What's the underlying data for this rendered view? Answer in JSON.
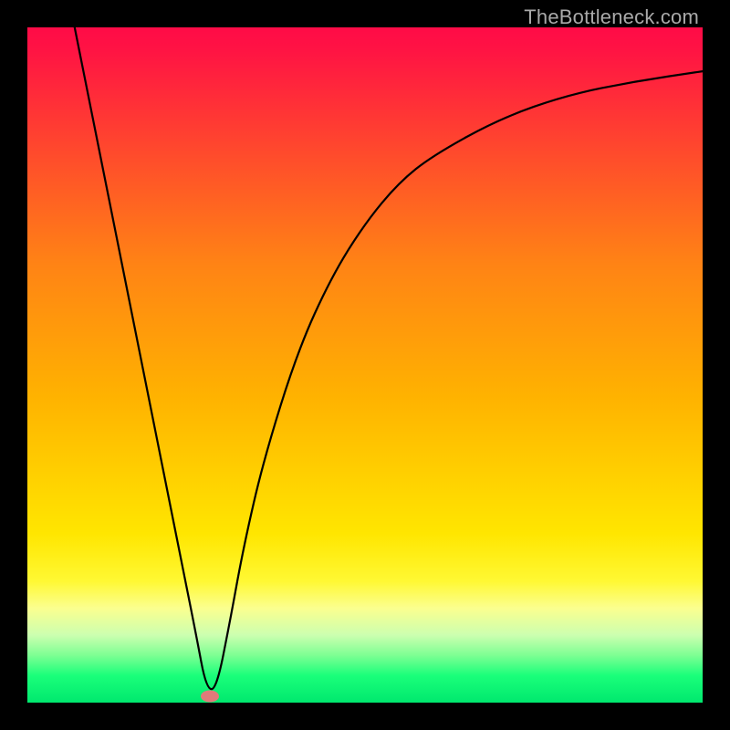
{
  "watermark": "TheBottleneck.com",
  "colors": {
    "background_frame": "#000000",
    "gradient_top": "#ff0b47",
    "gradient_bottom": "#00e86e",
    "curve_stroke": "#000000",
    "marker_fill": "#e07a7a",
    "watermark_text": "#a9a9a9"
  },
  "chart_data": {
    "type": "line",
    "title": "",
    "xlabel": "",
    "ylabel": "",
    "xlim": [
      0,
      1
    ],
    "ylim": [
      0,
      1
    ],
    "grid": false,
    "legend": false,
    "description": "V-shaped curve with vertex near x≈0.27 on a vertical red→green gradient background, black frame, site watermark top-right, small pink ellipse marker at the vertex.",
    "series": [
      {
        "name": "left-branch",
        "x": [
          0.07,
          0.09,
          0.11,
          0.13,
          0.15,
          0.17,
          0.19,
          0.21,
          0.23,
          0.25,
          0.265
        ],
        "values": [
          1.0,
          0.9,
          0.8,
          0.7,
          0.6,
          0.5,
          0.4,
          0.3,
          0.2,
          0.1,
          0.02
        ]
      },
      {
        "name": "right-branch",
        "x": [
          0.28,
          0.3,
          0.32,
          0.35,
          0.4,
          0.45,
          0.5,
          0.55,
          0.6,
          0.7,
          0.8,
          0.9,
          1.0
        ],
        "values": [
          0.02,
          0.12,
          0.23,
          0.36,
          0.52,
          0.63,
          0.71,
          0.77,
          0.81,
          0.865,
          0.9,
          0.92,
          0.935
        ]
      }
    ],
    "markers": [
      {
        "name": "vertex-marker",
        "x": 0.27,
        "y": 0.01
      }
    ]
  }
}
